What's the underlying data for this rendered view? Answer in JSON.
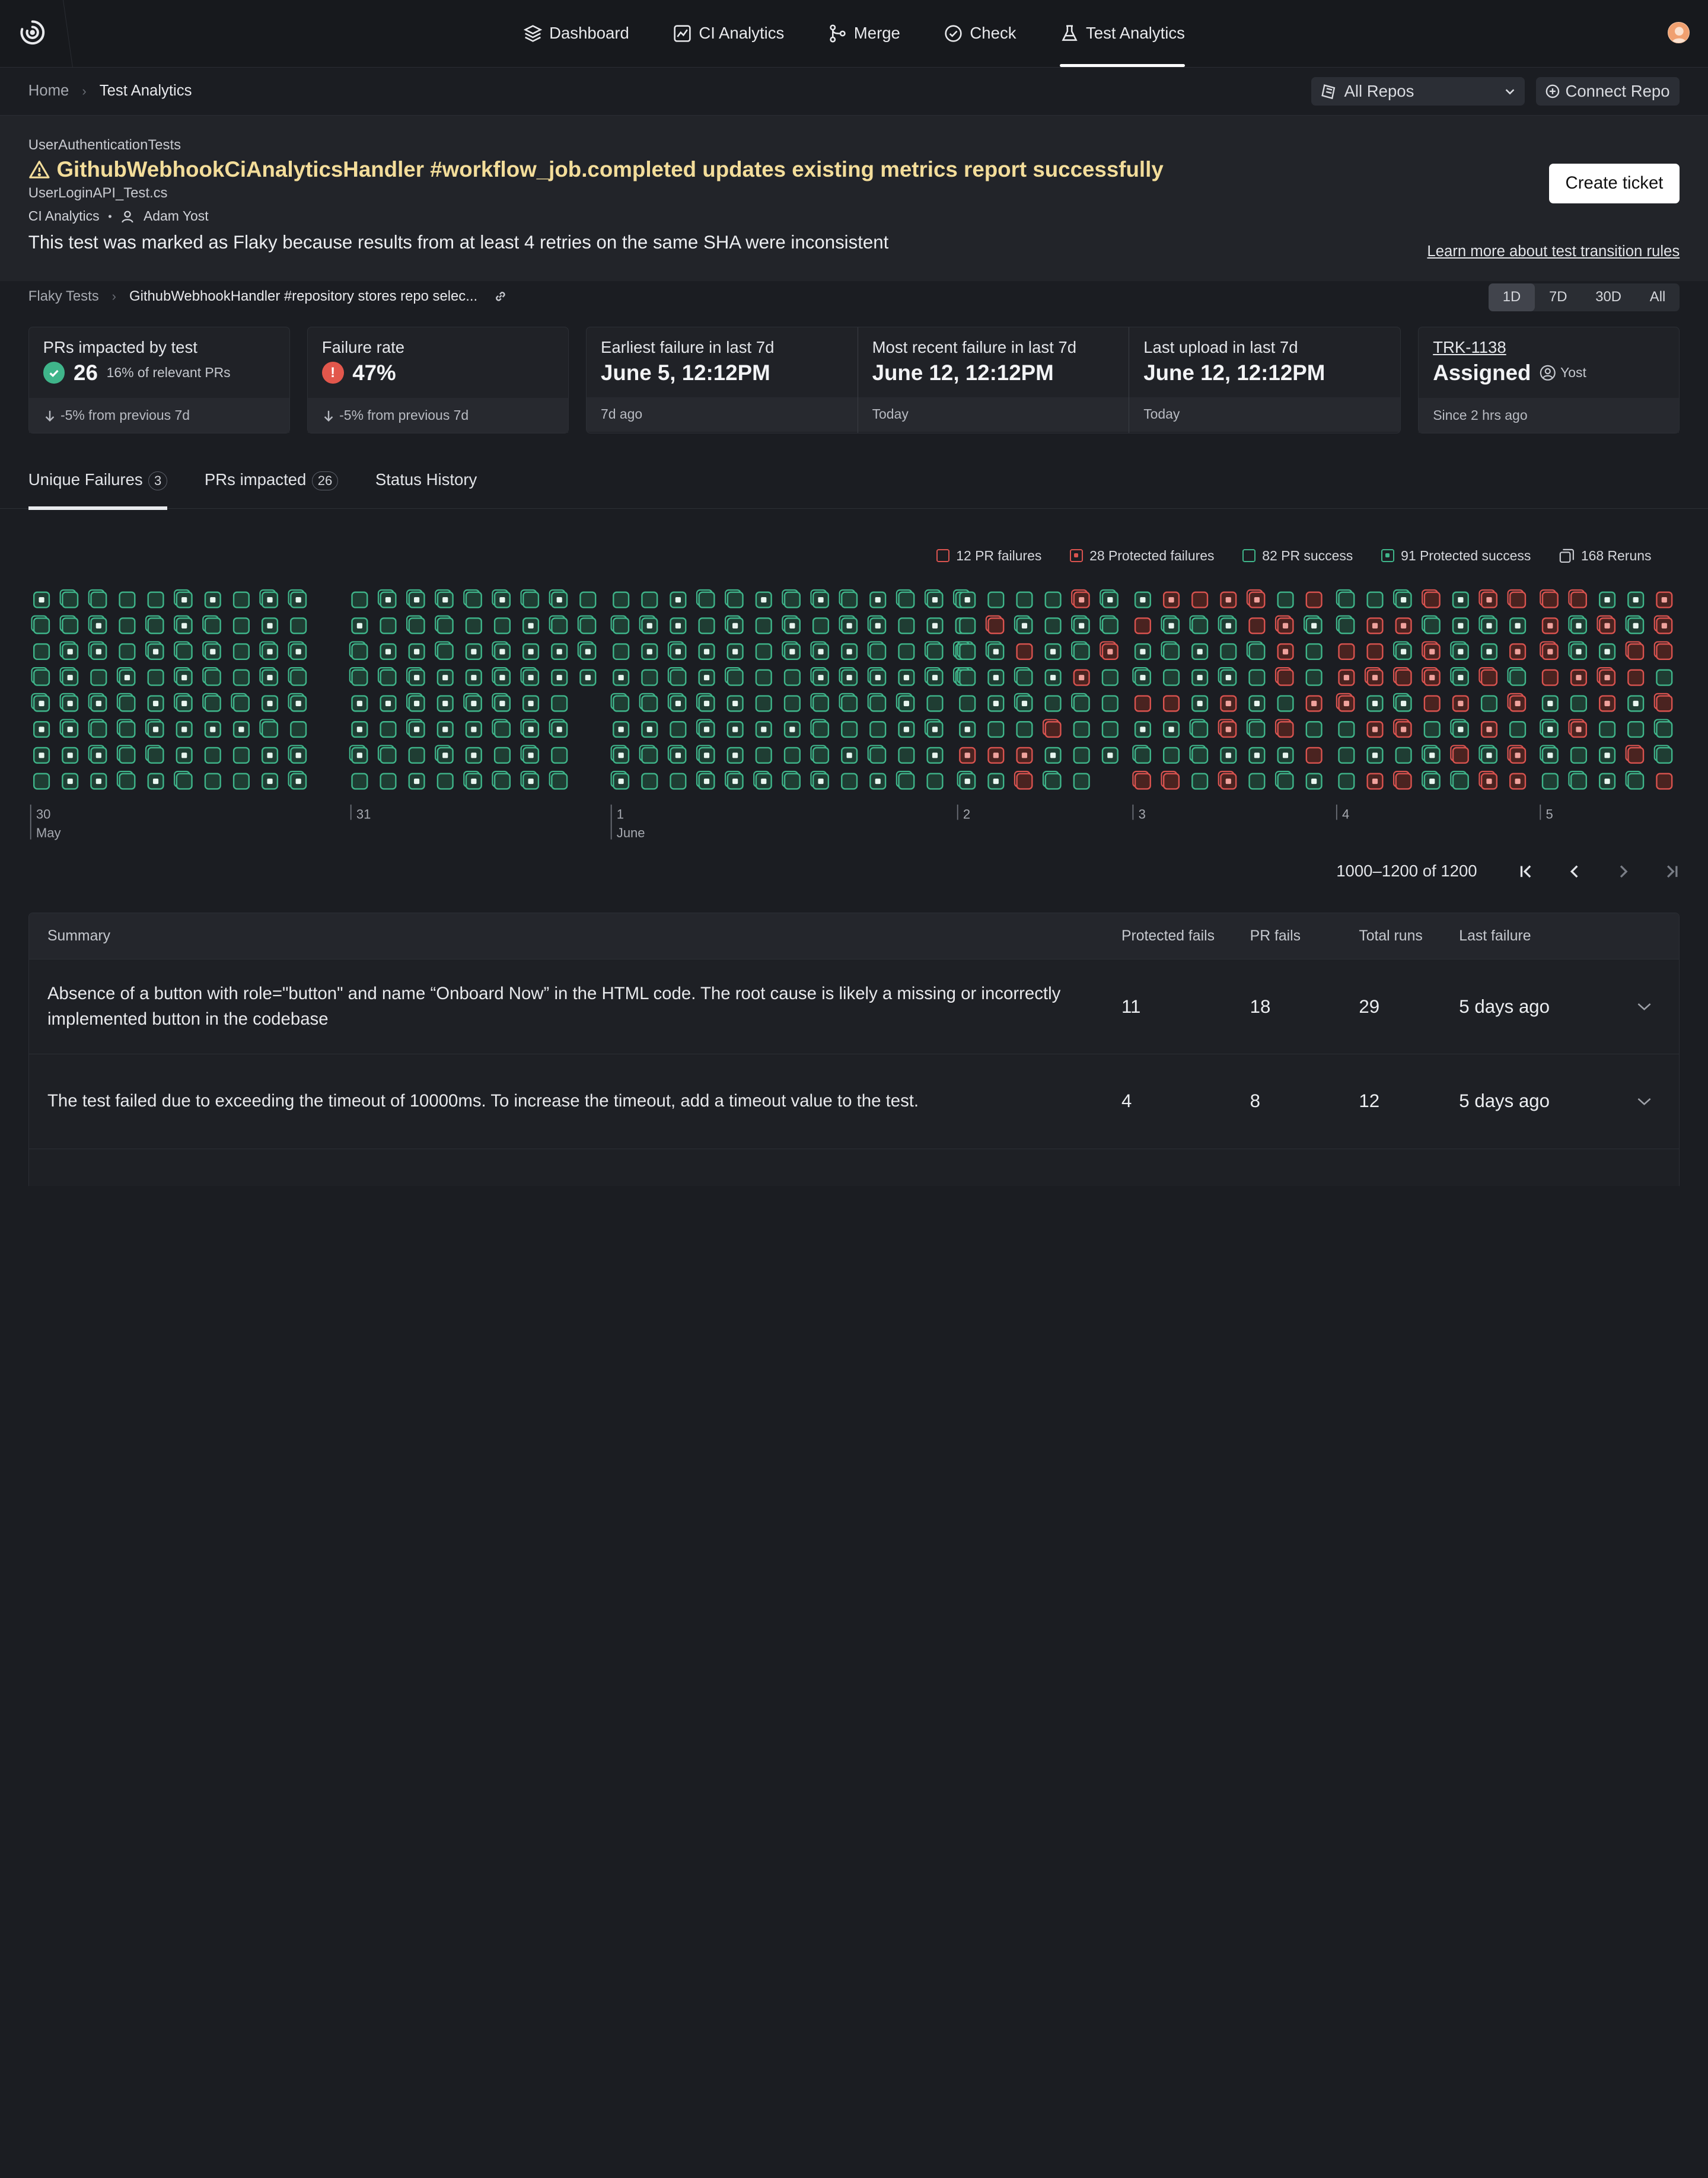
{
  "nav": {
    "items": [
      {
        "label": "Dashboard",
        "icon": "layers-icon"
      },
      {
        "label": "CI Analytics",
        "icon": "chart-icon"
      },
      {
        "label": "Merge",
        "icon": "merge-icon"
      },
      {
        "label": "Check",
        "icon": "check-circle-icon"
      },
      {
        "label": "Test Analytics",
        "icon": "flask-icon",
        "active": true
      }
    ]
  },
  "breadcrumb": {
    "home": "Home",
    "current": "Test Analytics"
  },
  "repo_select": {
    "value": "All Repos"
  },
  "connect_repo": {
    "label": "Connect Repo"
  },
  "test": {
    "suite": "UserAuthenticationTests",
    "title": "GithubWebhookCiAnalyticsHandler #workflow_job.completed updates existing metrics report successfully",
    "file": "UserLoginAPI_Test.cs",
    "team": "CI Analytics",
    "owner": "Adam Yost",
    "reason": "This test was marked as Flaky because results from at least 4 retries on the same SHA were inconsistent",
    "create_ticket": "Create ticket",
    "learn_more": "Learn more about test transition rules"
  },
  "subcrumb": {
    "parent": "Flaky Tests",
    "current": "GithubWebhookHandler #repository stores repo selec..."
  },
  "ranges": [
    "1D",
    "7D",
    "30D",
    "All"
  ],
  "active_range": "1D",
  "stats": {
    "prs": {
      "label": "PRs impacted by test",
      "value": "26",
      "sub": "16% of relevant PRs",
      "foot": "-5% from previous 7d"
    },
    "failure": {
      "label": "Failure rate",
      "value": "47%",
      "foot": "-5% from previous 7d"
    },
    "earliest": {
      "label": "Earliest failure in last 7d",
      "value": "June 5, 12:12PM",
      "foot": "7d ago"
    },
    "recent": {
      "label": "Most recent failure in last 7d",
      "value": "June 12, 12:12PM",
      "foot": "Today"
    },
    "upload": {
      "label": "Last upload in last 7d",
      "value": "June 12, 12:12PM",
      "foot": "Today"
    },
    "ticket": {
      "id": "TRK-1138",
      "status": "Assigned",
      "assignee": "Yost",
      "foot": "Since 2 hrs ago"
    }
  },
  "tabs": [
    {
      "label": "Unique Failures",
      "count": "3",
      "active": true
    },
    {
      "label": "PRs impacted",
      "count": "26"
    },
    {
      "label": "Status History",
      "count": ""
    }
  ],
  "legend": {
    "pr_failures": "12 PR failures",
    "protected_failures": "28 Protected failures",
    "pr_success": "82 PR success",
    "protected_success": "91 Protected success",
    "reruns": "168 Reruns"
  },
  "colors": {
    "success": "#3fb58a",
    "failure": "#d9534f",
    "warning": "#f3dd9a"
  },
  "timeline_labels": [
    {
      "day": "30",
      "month": "May"
    },
    {
      "day": "31",
      "month": ""
    },
    {
      "day": "1",
      "month": "June"
    },
    {
      "day": "2",
      "month": ""
    },
    {
      "day": "3",
      "month": ""
    },
    {
      "day": "4",
      "month": ""
    },
    {
      "day": "5",
      "month": ""
    }
  ],
  "pager": {
    "range": "1000–1200 of 1200"
  },
  "table": {
    "headers": {
      "summary": "Summary",
      "protected": "Protected fails",
      "pr": "PR fails",
      "total": "Total runs",
      "last": "Last failure"
    },
    "rows": [
      {
        "summary": "Absence of a button with role=\"button\" and name “Onboard Now” in the HTML code. The root cause is likely a missing or incorrectly implemented button in the codebase",
        "protected": "11",
        "pr": "18",
        "total": "29",
        "last": "5 days ago"
      },
      {
        "summary": "The test failed due to exceeding the timeout of 10000ms. To increase the timeout, add a timeout value to the test.",
        "protected": "4",
        "pr": "8",
        "total": "12",
        "last": "5 days ago"
      }
    ]
  }
}
